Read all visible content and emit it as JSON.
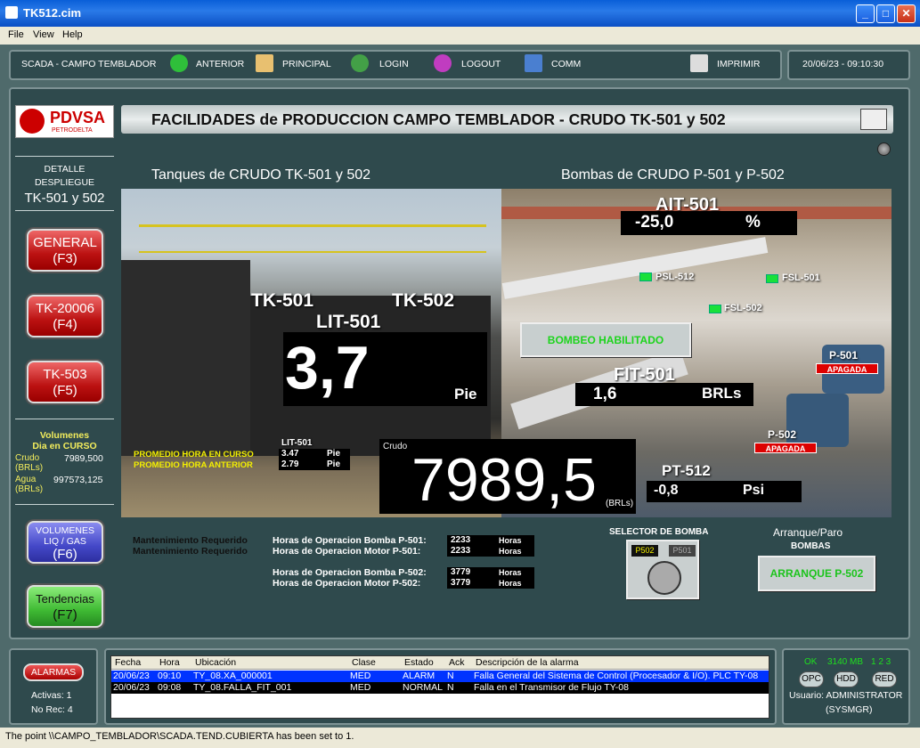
{
  "window": {
    "title": "TK512.cim"
  },
  "menu": {
    "file": "File",
    "view": "View",
    "help": "Help"
  },
  "toolbar": {
    "location": "SCADA - CAMPO TEMBLADOR",
    "anterior": "ANTERIOR",
    "principal": "PRINCIPAL",
    "login": "LOGIN",
    "logout": "LOGOUT",
    "comm": "COMM",
    "imprimir": "IMPRIMIR",
    "datetime": "20/06/23 - 09:10:30"
  },
  "logo": {
    "brand": "PDVSA",
    "sub": "PETRODELTA"
  },
  "sidebar": {
    "detail_1": "DETALLE",
    "detail_2": "DESPLIEGUE",
    "detail_3": "TK-501 y 502",
    "buttons": [
      {
        "label": "GENERAL",
        "key": "(F3)"
      },
      {
        "label": "TK-20006",
        "key": "(F4)"
      },
      {
        "label": "TK-503",
        "key": "(F5)"
      },
      {
        "label": "VOLUMENES LIQ / GAS",
        "key": "(F6)"
      },
      {
        "label": "Tendencias",
        "key": "(F7)"
      }
    ],
    "vol_title_1": "Volumenes",
    "vol_title_2": "Dia en CURSO",
    "crudo_label": "Crudo",
    "crudo_unit": "(BRLs)",
    "crudo_value": "7989,500",
    "agua_label": "Agua",
    "agua_unit": "(BRLs)",
    "agua_value": "997573,125"
  },
  "main": {
    "header": "FACILIDADES de PRODUCCION CAMPO TEMBLADOR - CRUDO TK-501 y 502",
    "tanks_title": "Tanques de CRUDO TK-501 y 502",
    "pumps_title": "Bombas de CRUDO P-501 y P-502",
    "tk501": "TK-501",
    "tk502": "TK-502",
    "lit_tag": "LIT-501",
    "lit_value": "3,7",
    "lit_unit": "Pie",
    "ait_tag": "AIT-501",
    "ait_value": "-25,0",
    "ait_unit": "%",
    "psl512": "PSL-512",
    "fsl501": "FSL-501",
    "fsl502": "FSL-502",
    "bombeo": "BOMBEO HABILITADO",
    "fit_tag": "FIT-501",
    "fit_value": "1,6",
    "fit_unit": "BRLs",
    "p501": "P-501",
    "p501_state": "APAGADA",
    "p502": "P-502",
    "p502_state": "APAGADA",
    "prom_curso": "PROMEDIO HORA EN CURSO",
    "prom_anterior": "PROMEDIO HORA ANTERIOR",
    "lit_small": "LIT-501",
    "prom_curso_val": "3.47",
    "prom_anterior_val": "2.79",
    "prom_unit": "Pie",
    "crudo_label": "Crudo",
    "crudo_value": "7989,5",
    "crudo_unit": "(BRLs)",
    "pt_tag": "PT-512",
    "pt_value": "-0,8",
    "pt_unit": "Psi"
  },
  "maintenance": {
    "req1": "Mantenimiento Requerido",
    "req2": "Mantenimiento Requerido",
    "rows": [
      {
        "label": "Horas de Operacion Bomba P-501:",
        "value": "2233",
        "unit": "Horas"
      },
      {
        "label": "Horas de Operacion Motor P-501:",
        "value": "2233",
        "unit": "Horas"
      },
      {
        "label": "Horas de Operacion Bomba P-502:",
        "value": "3779",
        "unit": "Horas"
      },
      {
        "label": "Horas de Operacion Motor P-502:",
        "value": "3779",
        "unit": "Horas"
      }
    ]
  },
  "selector": {
    "title": "SELECTOR DE BOMBA",
    "opt1": "P502",
    "opt2": "P501"
  },
  "arranque": {
    "title": "Arranque/Paro",
    "sub": "BOMBAS",
    "button": "ARRANQUE P-502"
  },
  "alarms": {
    "button": "ALARMAS",
    "activas": "Activas: 1",
    "norec": "No Rec: 4",
    "headers": [
      "Fecha",
      "Hora",
      "Ubicación",
      "Clase",
      "Estado",
      "Ack",
      "Descripción de la alarma"
    ],
    "rows": [
      [
        "20/06/23",
        "09:10",
        "TY_08.XA_000001",
        "MED",
        "ALARM",
        "N",
        "Falla General del Sistema de Control (Procesador & I/O). PLC TY-08"
      ],
      [
        "20/06/23",
        "09:08",
        "TY_08.FALLA_FIT_001",
        "MED",
        "NORMAL",
        "N",
        "Falla en el Transmisor de Flujo TY-08"
      ]
    ]
  },
  "system": {
    "ok": "OK",
    "mem": "3140 MB",
    "nums": "1 2 3",
    "opc": "OPC",
    "hdd": "HDD",
    "red": "RED",
    "user": "Usuario: ADMINISTRATOR",
    "group": "(SYSMGR)"
  },
  "status": {
    "text": "The point \\\\CAMPO_TEMBLADOR\\SCADA.TEND.CUBIERTA has been set to 1."
  }
}
